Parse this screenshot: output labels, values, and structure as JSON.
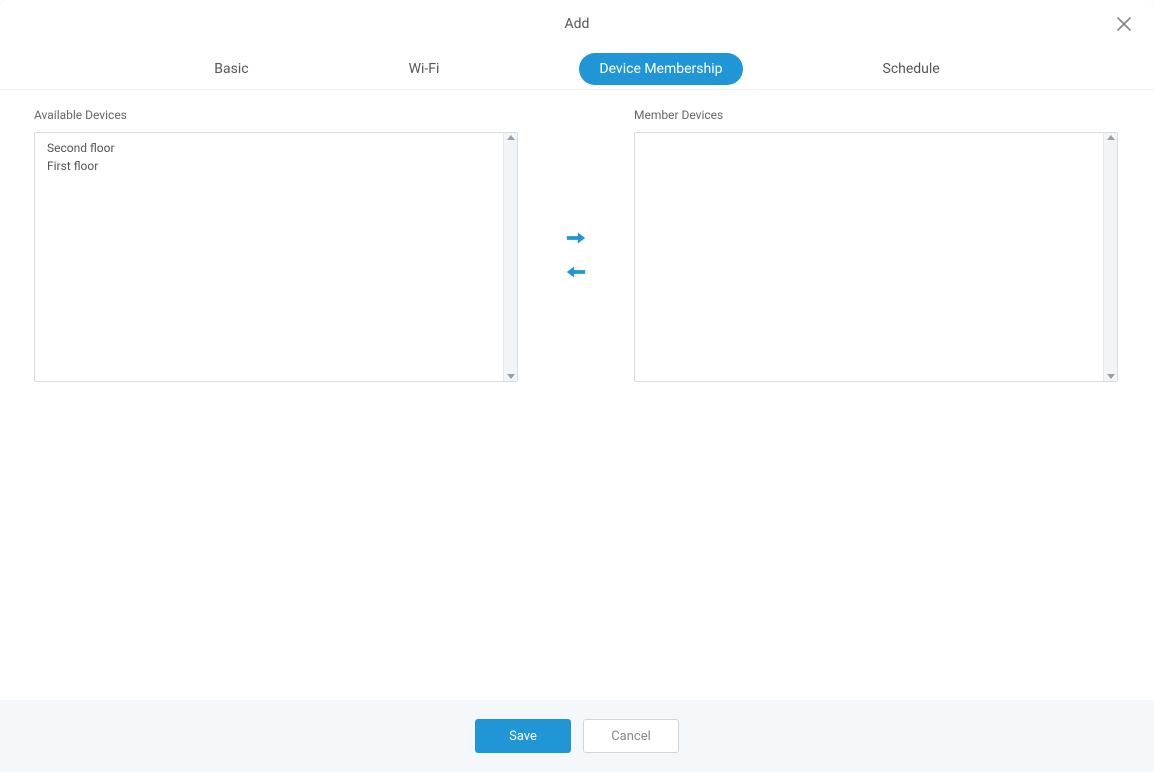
{
  "dialog": {
    "title": "Add"
  },
  "tabs": [
    {
      "id": "basic",
      "label": "Basic",
      "active": false
    },
    {
      "id": "wifi",
      "label": "Wi-Fi",
      "active": false
    },
    {
      "id": "device-membership",
      "label": "Device Membership",
      "active": true
    },
    {
      "id": "schedule",
      "label": "Schedule",
      "active": false
    }
  ],
  "panels": {
    "available": {
      "label": "Available Devices",
      "items": [
        "Second floor",
        "First floor"
      ]
    },
    "member": {
      "label": "Member Devices",
      "items": []
    }
  },
  "buttons": {
    "save": "Save",
    "cancel": "Cancel"
  },
  "icons": {
    "close": "close-icon",
    "arrow_right": "arrow-right-icon",
    "arrow_left": "arrow-left-icon"
  },
  "colors": {
    "accent": "#2196d6",
    "footer_bg": "#f4f8fb",
    "border": "#d8dde1"
  }
}
